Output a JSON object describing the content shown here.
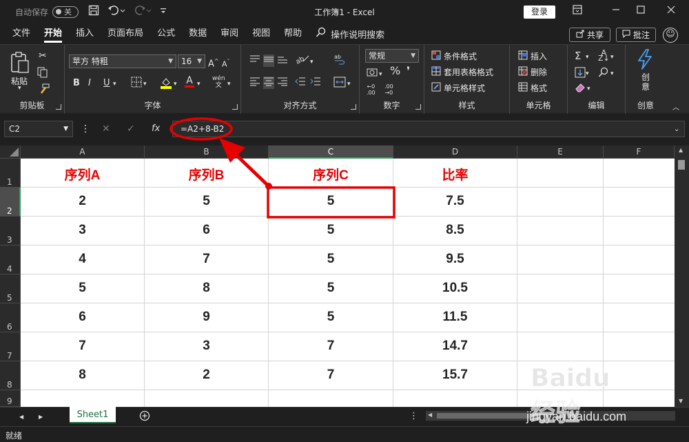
{
  "titlebar": {
    "autosave_label": "自动保存",
    "autosave_state": "关",
    "window_title": "工作簿1  -  Excel",
    "login_label": "登录"
  },
  "tabs": [
    "文件",
    "开始",
    "插入",
    "页面布局",
    "公式",
    "数据",
    "审阅",
    "视图",
    "帮助"
  ],
  "active_tab": "开始",
  "tell_me": "操作说明搜索",
  "share_label": "共享",
  "comment_label": "批注",
  "ribbon": {
    "clipboard": {
      "paste": "粘贴",
      "label": "剪贴板"
    },
    "font": {
      "name": "苹方 特粗",
      "size": "16",
      "label": "字体",
      "bold": "B",
      "italic": "I",
      "underline": "U",
      "wen": "wén"
    },
    "alignment": {
      "label": "对齐方式"
    },
    "number": {
      "format": "常规",
      "percent": "%",
      "label": "数字"
    },
    "styles": {
      "conditional": "条件格式",
      "table": "套用表格格式",
      "cell": "单元格样式",
      "label": "样式"
    },
    "cells": {
      "insert": "插入",
      "delete": "删除",
      "format": "格式",
      "label": "单元格"
    },
    "editing": {
      "label": "编辑"
    },
    "create": {
      "button": "创意",
      "label": "创意"
    }
  },
  "formula_bar": {
    "name_box": "C2",
    "fx": "fx",
    "formula": "=A2+8-B2"
  },
  "columns": [
    "A",
    "B",
    "C",
    "D",
    "E",
    "F"
  ],
  "selected_column": "C",
  "rows": [
    "1",
    "2",
    "3",
    "4",
    "5",
    "6",
    "7",
    "8",
    "9"
  ],
  "selected_row": "2",
  "table": {
    "headers": [
      "序列A",
      "序列B",
      "序列C",
      "比率"
    ],
    "data": [
      [
        "2",
        "5",
        "5",
        "7.5"
      ],
      [
        "3",
        "6",
        "5",
        "8.5"
      ],
      [
        "4",
        "7",
        "5",
        "9.5"
      ],
      [
        "5",
        "8",
        "5",
        "10.5"
      ],
      [
        "6",
        "9",
        "5",
        "11.5"
      ],
      [
        "7",
        "3",
        "7",
        "14.7"
      ],
      [
        "8",
        "2",
        "7",
        "15.7"
      ]
    ]
  },
  "sheet_tabs": [
    "Sheet1"
  ],
  "status": "就绪",
  "watermark": {
    "logo_text": "Baidu经验",
    "url": "jingyan.baidu.com"
  },
  "colors": {
    "header_text": "#e60000",
    "annotation": "#e60000",
    "accent": "#1e7145"
  }
}
